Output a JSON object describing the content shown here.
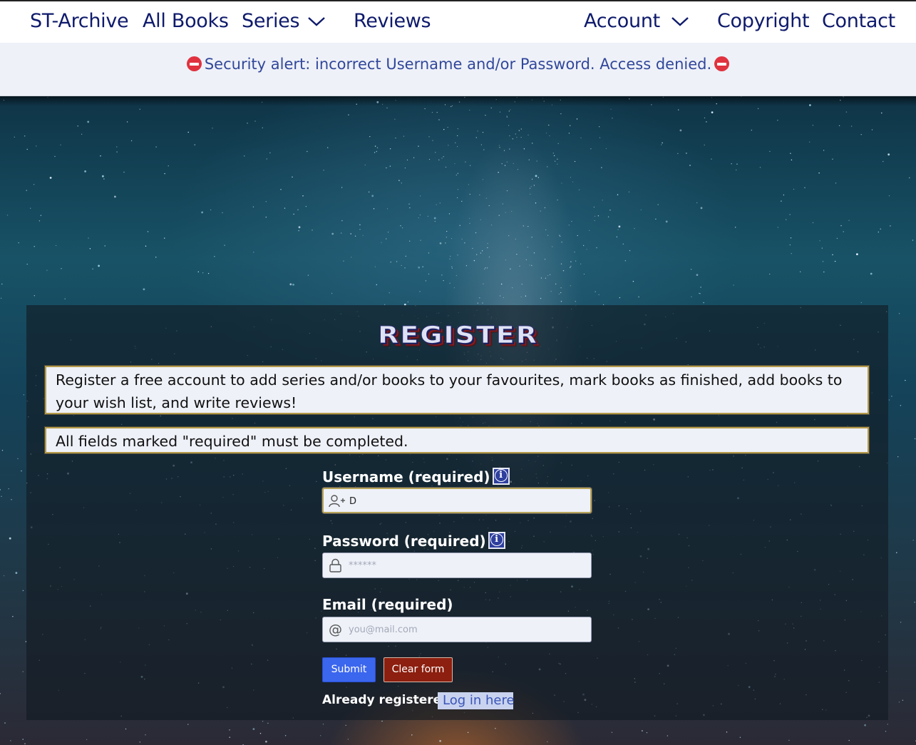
{
  "nav": {
    "brand": "ST-Archive",
    "all_books": "All Books",
    "series": "Series",
    "reviews": "Reviews",
    "account": "Account",
    "copyright": "Copyright",
    "contact": "Contact"
  },
  "alert": {
    "text": "Security alert: incorrect Username and/or Password. Access denied.",
    "icon": "stop-icon",
    "color": "#e0323f"
  },
  "register": {
    "title": "REGISTER",
    "intro": "Register a free account to add series and/or books to your favourites, mark books as finished, add books to your wish list, and write reviews!",
    "required_note": "All fields marked \"required\" must be completed.",
    "username": {
      "label": "Username (required)",
      "value": "D",
      "icon": "user-plus-icon"
    },
    "password": {
      "label": "Password (required)",
      "placeholder": "******",
      "icon": "lock-icon"
    },
    "email": {
      "label": "Email (required)",
      "placeholder": "you@mail.com",
      "icon": "at-icon"
    },
    "submit_label": "Submit",
    "clear_label": "Clear form",
    "already_text": "Already registered?",
    "login_link": "Log in here"
  },
  "colors": {
    "nav_text": "#0e1a6b",
    "submit": "#3b66ee",
    "clear": "#8c1f0f"
  }
}
